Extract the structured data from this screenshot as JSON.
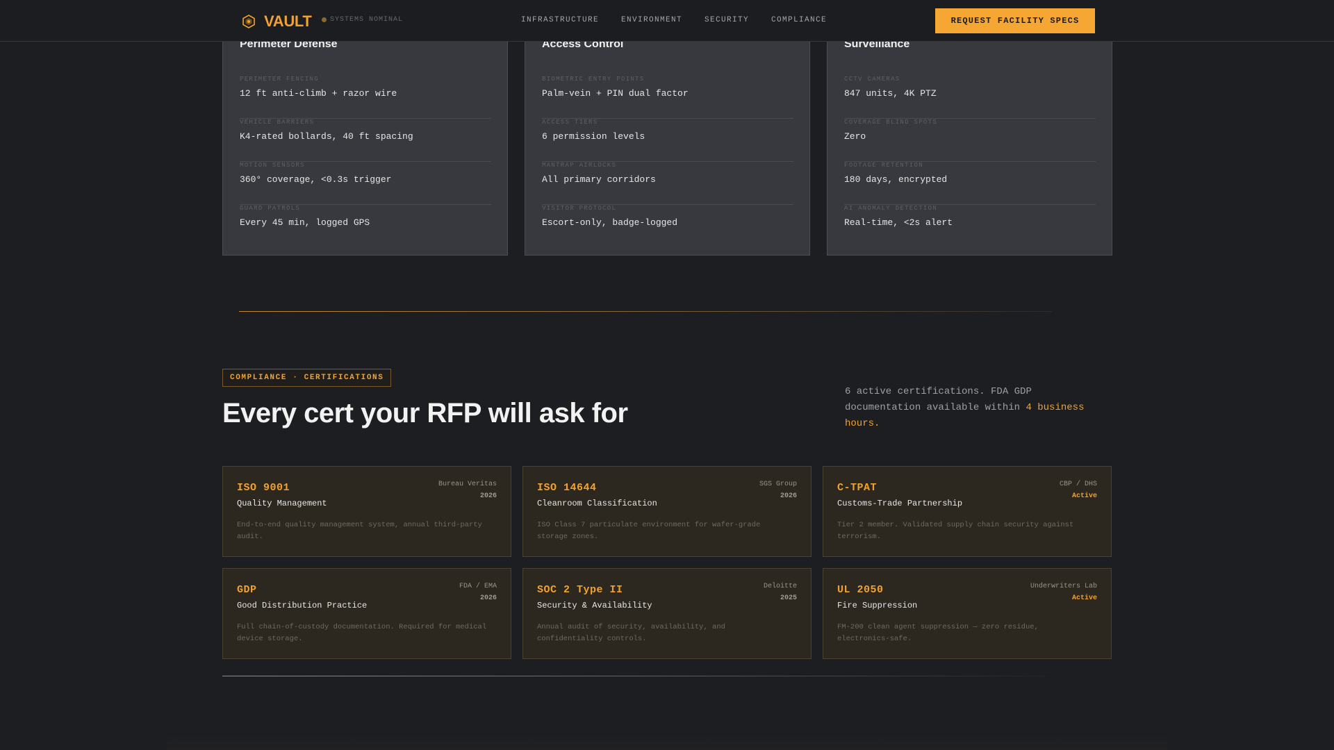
{
  "nav": {
    "brand": "VAULT",
    "status": "SYSTEMS NOMINAL",
    "links": [
      "INFRASTRUCTURE",
      "ENVIRONMENT",
      "SECURITY",
      "COMPLIANCE"
    ],
    "cta": "REQUEST FACILITY SPECS"
  },
  "security": [
    {
      "title": "Perimeter Defense",
      "rows": [
        {
          "label": "PERIMETER FENCING",
          "value": "12 ft anti-climb + razor wire"
        },
        {
          "label": "VEHICLE BARRIERS",
          "value": "K4-rated bollards, 40 ft spacing"
        },
        {
          "label": "MOTION SENSORS",
          "value": "360° coverage, <0.3s trigger"
        },
        {
          "label": "GUARD PATROLS",
          "value": "Every 45 min, logged GPS"
        }
      ]
    },
    {
      "title": "Access Control",
      "rows": [
        {
          "label": "BIOMETRIC ENTRY POINTS",
          "value": "Palm-vein + PIN dual factor"
        },
        {
          "label": "ACCESS TIERS",
          "value": "6 permission levels"
        },
        {
          "label": "MANTRAP AIRLOCKS",
          "value": "All primary corridors"
        },
        {
          "label": "VISITOR PROTOCOL",
          "value": "Escort-only, badge-logged"
        }
      ]
    },
    {
      "title": "Surveillance",
      "rows": [
        {
          "label": "CCTV CAMERAS",
          "value": "847 units, 4K PTZ"
        },
        {
          "label": "COVERAGE BLIND SPOTS",
          "value": "Zero"
        },
        {
          "label": "FOOTAGE RETENTION",
          "value": "180 days, encrypted"
        },
        {
          "label": "AI ANOMALY DETECTION",
          "value": "Real-time, <2s alert"
        }
      ]
    }
  ],
  "compliance": {
    "tag": "COMPLIANCE · CERTIFICATIONS",
    "heading": "Every cert your RFP will ask for",
    "intro_prefix": "6 active certifications. FDA GDP documentation available within ",
    "intro_highlight": "4 business hours.",
    "certs": [
      {
        "code": "ISO 9001",
        "name": "Quality Management",
        "issuer": "Bureau Veritas",
        "year": "2026",
        "desc": "End-to-end quality management system, annual third-party audit."
      },
      {
        "code": "ISO 14644",
        "name": "Cleanroom Classification",
        "issuer": "SGS Group",
        "year": "2026",
        "desc": "ISO Class 7 particulate environment for wafer-grade storage zones."
      },
      {
        "code": "C-TPAT",
        "name": "Customs-Trade Partnership",
        "issuer": "CBP / DHS",
        "year": "Active",
        "desc": "Tier 2 member. Validated supply chain security against terrorism."
      },
      {
        "code": "GDP",
        "name": "Good Distribution Practice",
        "issuer": "FDA / EMA",
        "year": "2026",
        "desc": "Full chain-of-custody documentation. Required for medical device storage."
      },
      {
        "code": "SOC 2 Type II",
        "name": "Security & Availability",
        "issuer": "Deloitte",
        "year": "2025",
        "desc": "Annual audit of security, availability, and confidentiality controls."
      },
      {
        "code": "UL 2050",
        "name": "Fire Suppression",
        "issuer": "Underwriters Lab",
        "year": "Active",
        "desc": "FM-200 clean agent suppression — zero residue, electronics-safe."
      }
    ]
  },
  "colors": {
    "accent": "#f2a230",
    "background": "#1d1e21",
    "card": "#38393e",
    "cert_card": "#2c2820"
  }
}
